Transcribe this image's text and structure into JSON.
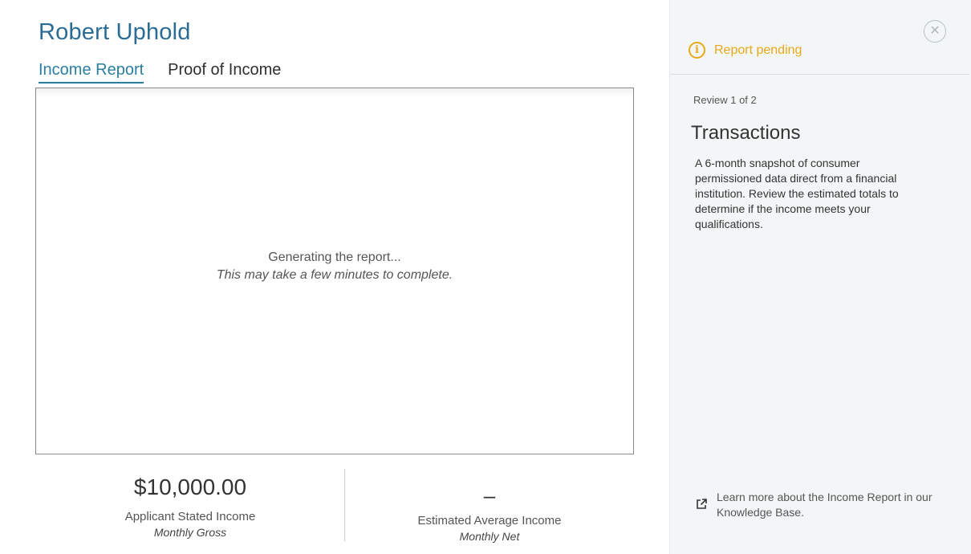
{
  "applicant": {
    "name": "Robert Uphold"
  },
  "tabs": [
    {
      "label": "Income Report",
      "active": true
    },
    {
      "label": "Proof of Income",
      "active": false
    }
  ],
  "report": {
    "status_line": "Generating the report...",
    "status_sub": "This may take a few minutes to complete."
  },
  "summary": {
    "stated": {
      "amount": "$10,000.00",
      "label": "Applicant Stated Income",
      "sub": "Monthly Gross"
    },
    "estimated": {
      "amount": "–",
      "label": "Estimated Average Income",
      "sub": "Monthly Net"
    }
  },
  "panel": {
    "close_icon": "close-icon",
    "status": {
      "icon": "info-icon",
      "text": "Report pending",
      "color": "#e8a818"
    },
    "review_count": "Review 1 of 2",
    "title": "Transactions",
    "description": "A 6-month snapshot of consumer permissioned data direct from a financial institution. Review the estimated totals to determine if the income meets your qualifications.",
    "kb_link": {
      "icon": "external-link-icon",
      "text": "Learn more about the Income Report in our Knowledge Base."
    }
  },
  "colors": {
    "accent": "#2a7f9e",
    "name": "#2b6c94",
    "pending": "#e8a818",
    "panel_bg": "#f3f6f7"
  }
}
